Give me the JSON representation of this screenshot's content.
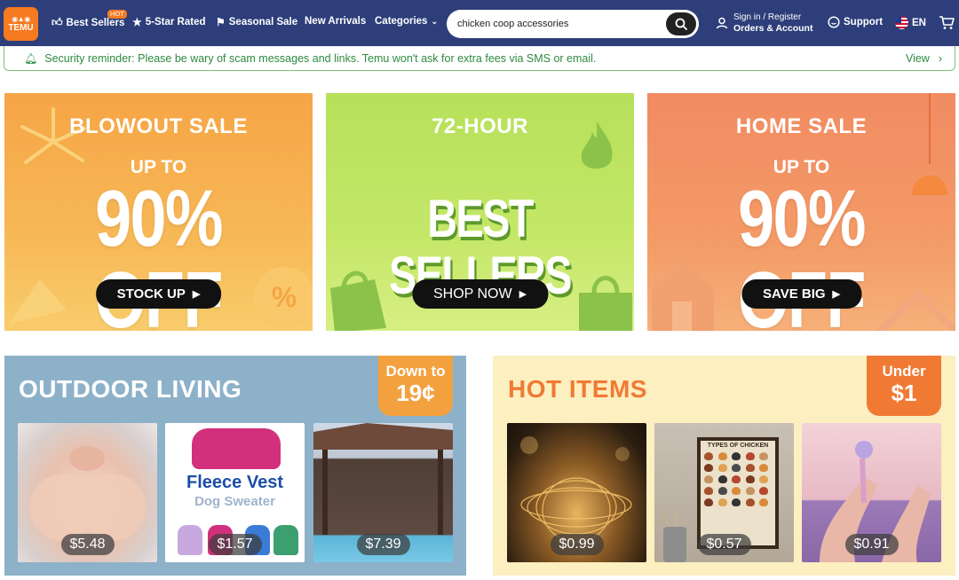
{
  "header": {
    "logo_text": "TEMU",
    "nav": [
      {
        "label": "Best Sellers",
        "badge": "HOT"
      },
      {
        "label": "5-Star Rated"
      },
      {
        "label": "Seasonal Sale"
      },
      {
        "label": "New Arrivals"
      },
      {
        "label": "Categories"
      }
    ],
    "search": {
      "value": "chicken coop accessories"
    },
    "account": {
      "line1": "Sign in / Register",
      "line2": "Orders & Account"
    },
    "support": "Support",
    "language": "EN"
  },
  "security_banner": {
    "message": "Security reminder: Please be wary of scam messages and links. Temu won't ask for extra fees via SMS or email.",
    "link": "View"
  },
  "promos": [
    {
      "title": "BLOWOUT SALE",
      "subtitle": "UP TO",
      "headline": "90% OFF",
      "cta": "STOCK UP"
    },
    {
      "title": "72-HOUR",
      "headline": "BEST SELLERS",
      "cta": "SHOP NOW"
    },
    {
      "title": "HOME SALE",
      "subtitle": "UP TO",
      "headline": "90% OFF",
      "cta": "SAVE BIG"
    }
  ],
  "panels": {
    "outdoor": {
      "title": "OUTDOOR LIVING",
      "tag_line1": "Down to",
      "tag_line2": "19¢",
      "products": [
        {
          "price": "$5.48"
        },
        {
          "price": "$1.57",
          "title": "Fleece Vest",
          "subtitle": "Dog Sweater"
        },
        {
          "price": "$7.39"
        }
      ]
    },
    "hot": {
      "title": "HOT ITEMS",
      "tag_line1": "Under",
      "tag_line2": "$1",
      "products": [
        {
          "price": "$0.99"
        },
        {
          "price": "$0.57",
          "board_title": "TYPES OF CHICKEN"
        },
        {
          "price": "$0.91"
        }
      ]
    }
  },
  "colors": {
    "header_bg": "#2d3e7a",
    "brand_orange": "#f67a1f",
    "security_green": "#2d8a3e"
  }
}
